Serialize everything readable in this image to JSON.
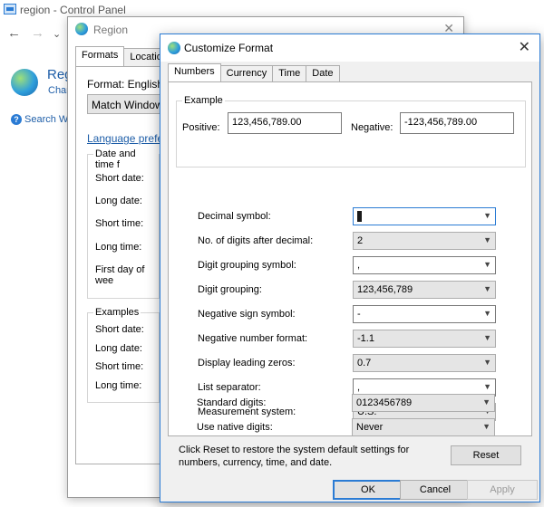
{
  "control_panel": {
    "title": "region - Control Panel",
    "nav": [
      "←",
      "→",
      "⌄"
    ],
    "heading": "Regi",
    "subheading": "Char",
    "search_help": "Search Wi"
  },
  "region_dialog": {
    "title": "Region",
    "close": "✕",
    "tabs": [
      "Formats",
      "Location"
    ],
    "format_label": "Format: English (",
    "format_value": "Match Windows",
    "language_link": "Language prefere",
    "date_time_group": {
      "title": "Date and time f",
      "rows": [
        "Short date:",
        "Long date:",
        "Short time:",
        "Long time:",
        "First day of wee"
      ]
    },
    "examples_group": {
      "title": "Examples",
      "rows": [
        "Short date:",
        "Long date:",
        "Short time:",
        "Long time:"
      ]
    }
  },
  "customize_dialog": {
    "title": "Customize Format",
    "close": "✕",
    "tabs": [
      "Numbers",
      "Currency",
      "Time",
      "Date"
    ],
    "example": {
      "title": "Example",
      "positive_label": "Positive:",
      "positive_value": "123,456,789.00",
      "negative_label": "Negative:",
      "negative_value": "-123,456,789.00"
    },
    "fields": [
      {
        "label": "Decimal symbol:",
        "value": "",
        "editable": true,
        "focused": true
      },
      {
        "label": "No. of digits after decimal:",
        "value": "2",
        "editable": false
      },
      {
        "label": "Digit grouping symbol:",
        "value": ",",
        "editable": true
      },
      {
        "label": "Digit grouping:",
        "value": "123,456,789",
        "editable": false
      },
      {
        "label": "Negative sign symbol:",
        "value": "-",
        "editable": true
      },
      {
        "label": "Negative number format:",
        "value": "-1.1",
        "editable": false
      },
      {
        "label": "Display leading zeros:",
        "value": "0.7",
        "editable": false
      },
      {
        "label": "List separator:",
        "value": ",",
        "editable": true
      },
      {
        "label": "Measurement system:",
        "value": "U.S.",
        "editable": false
      },
      {
        "label": "Standard digits:",
        "value": "0123456789",
        "editable": false
      },
      {
        "label": "Use native digits:",
        "value": "Never",
        "editable": false
      }
    ],
    "note": "Click Reset to restore the system default settings for numbers, currency, time, and date.",
    "buttons": {
      "reset": "Reset",
      "ok": "OK",
      "cancel": "Cancel",
      "apply": "Apply"
    }
  },
  "colors": {
    "accent": "#2a7bd4",
    "link": "#1e5ea8",
    "dialog_bg": "#f0f0f0"
  }
}
